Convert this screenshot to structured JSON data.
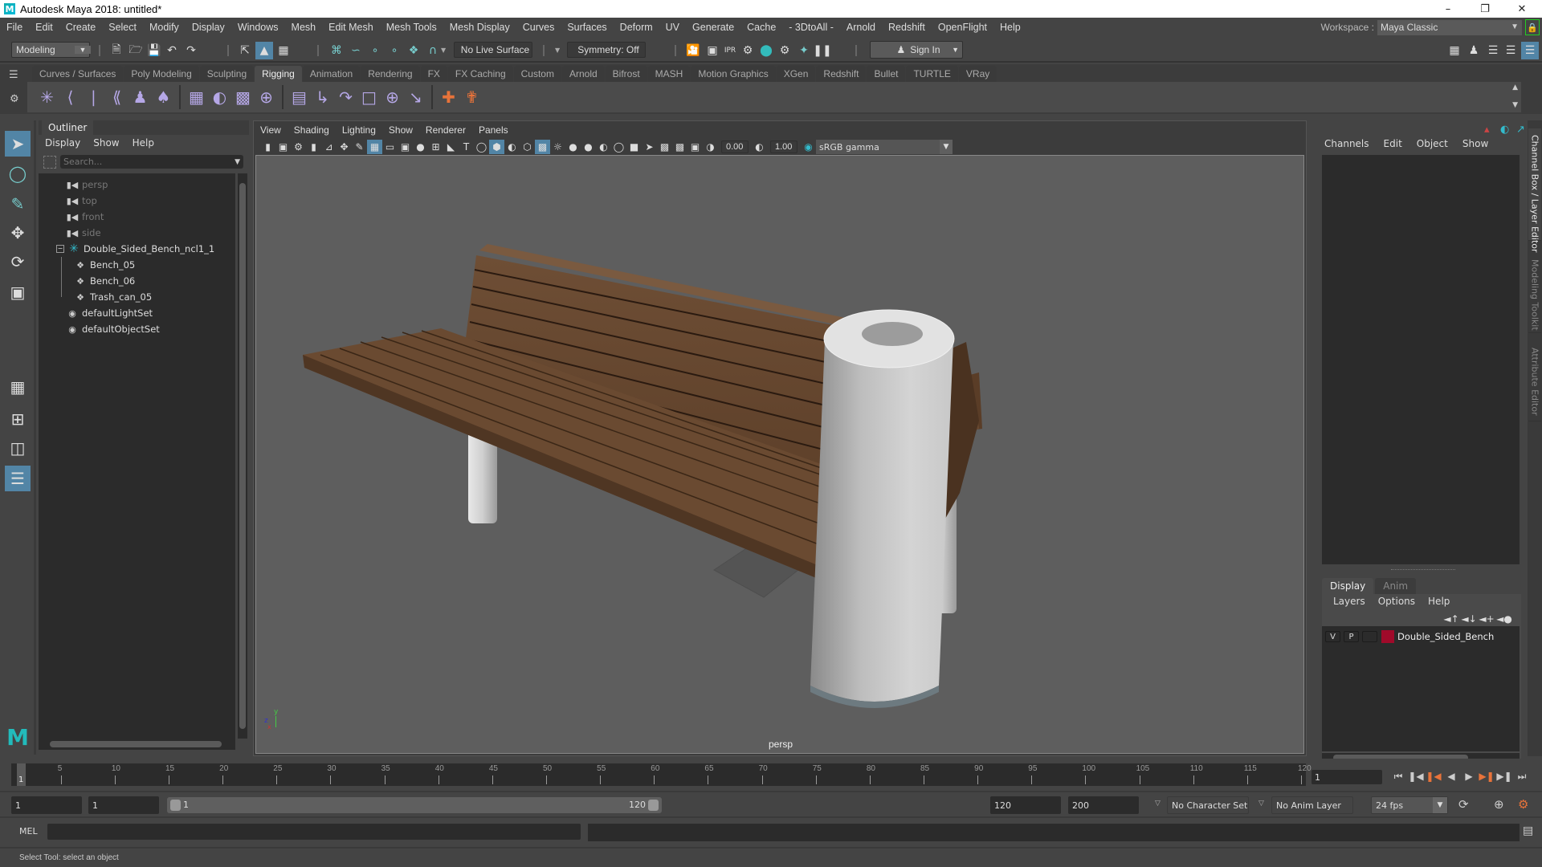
{
  "window": {
    "title": "Autodesk Maya 2018: untitled*",
    "logo": "M"
  },
  "menubar": [
    "File",
    "Edit",
    "Create",
    "Select",
    "Modify",
    "Display",
    "Windows",
    "Mesh",
    "Edit Mesh",
    "Mesh Tools",
    "Mesh Display",
    "Curves",
    "Surfaces",
    "Deform",
    "UV",
    "Generate",
    "Cache",
    "- 3DtoAll -",
    "Arnold",
    "Redshift",
    "OpenFlight",
    "Help"
  ],
  "workspace": {
    "label": "Workspace :",
    "value": "Maya Classic"
  },
  "statusline": {
    "menuset": "Modeling",
    "live_surface": "No Live Surface",
    "symmetry": "Symmetry: Off",
    "sign_in": "Sign In"
  },
  "shelf": {
    "tabs": [
      "Curves / Surfaces",
      "Poly Modeling",
      "Sculpting",
      "Rigging",
      "Animation",
      "Rendering",
      "FX",
      "FX Caching",
      "Custom",
      "Arnold",
      "Bifrost",
      "MASH",
      "Motion Graphics",
      "XGen",
      "Redshift",
      "Bullet",
      "TURTLE",
      "VRay"
    ],
    "active_tab": "Rigging",
    "icons": [
      "joint-tool-icon",
      "ik-handle-icon",
      "ik-spline-icon",
      "create-ikspline-icon",
      "humanik-icon",
      "quick-rig-icon",
      "bind-skin-icon",
      "smooth-bind-icon",
      "lattice-icon",
      "cluster-icon",
      "parent-constraint-icon",
      "point-constraint-icon",
      "orient-constraint-icon",
      "scale-constraint-icon",
      "aim-constraint-icon",
      "pole-vector-icon",
      "add-influence-icon",
      "remove-influence-icon"
    ]
  },
  "outliner": {
    "title": "Outliner",
    "menu": [
      "Display",
      "Show",
      "Help"
    ],
    "search_placeholder": "Search...",
    "items": [
      {
        "label": "persp",
        "type": "camera",
        "dim": true,
        "indent": 0
      },
      {
        "label": "top",
        "type": "camera",
        "dim": true,
        "indent": 0
      },
      {
        "label": "front",
        "type": "camera",
        "dim": true,
        "indent": 0
      },
      {
        "label": "side",
        "type": "camera",
        "dim": true,
        "indent": 0
      },
      {
        "label": "Double_Sided_Bench_ncl1_1",
        "type": "group",
        "dim": false,
        "indent": 0,
        "expanded": true
      },
      {
        "label": "Bench_05",
        "type": "mesh",
        "dim": false,
        "indent": 1
      },
      {
        "label": "Bench_06",
        "type": "mesh",
        "dim": false,
        "indent": 1
      },
      {
        "label": "Trash_can_05",
        "type": "mesh",
        "dim": false,
        "indent": 1
      },
      {
        "label": "defaultLightSet",
        "type": "set",
        "dim": false,
        "indent": 0
      },
      {
        "label": "defaultObjectSet",
        "type": "set",
        "dim": false,
        "indent": 0
      }
    ]
  },
  "viewport": {
    "menu": [
      "View",
      "Shading",
      "Lighting",
      "Show",
      "Renderer",
      "Panels"
    ],
    "exposure": "0.00",
    "gamma": "1.00",
    "color_management": "sRGB gamma",
    "camera_label": "persp",
    "axis": {
      "y": "y",
      "z": "z",
      "x": "x"
    },
    "scene_objects": [
      "Bench_05",
      "Bench_06",
      "Trash_can_05"
    ]
  },
  "channelbox": {
    "menu": [
      "Channels",
      "Edit",
      "Object",
      "Show"
    ]
  },
  "layer_editor": {
    "tabs": [
      "Display",
      "Anim"
    ],
    "active_tab": "Display",
    "menu": [
      "Layers",
      "Options",
      "Help"
    ],
    "layers": [
      {
        "v": "V",
        "p": "P",
        "name": "Double_Sided_Bench",
        "color": "#a00a2a"
      }
    ]
  },
  "side_tabs": [
    "Channel Box / Layer Editor",
    "Modeling Toolkit",
    "Attribute Editor"
  ],
  "timeslider": {
    "ticks": [
      5,
      10,
      15,
      20,
      25,
      30,
      35,
      40,
      45,
      50,
      55,
      60,
      65,
      70,
      75,
      80,
      85,
      90,
      95,
      100,
      105,
      110,
      115,
      120
    ],
    "start": 1,
    "end": 120,
    "current": "1",
    "current_frame_field": "1"
  },
  "rangeslider": {
    "start_field": "1",
    "playback_start": "1",
    "range_start_label": "1",
    "range_end_label": "120",
    "playback_end": "120",
    "end_field": "200",
    "character_set": "No Character Set",
    "anim_layer": "No Anim Layer",
    "fps": "24 fps"
  },
  "mel": {
    "label": "MEL",
    "value": ""
  },
  "helpline": "Select Tool: select an object",
  "colors": {
    "accent": "#5285a6",
    "panel": "#444444",
    "field": "#2b2b2b",
    "viewport": "#5e5e5e",
    "rig_icon": "#b5a7e6",
    "layer_color": "#a00a2a"
  }
}
